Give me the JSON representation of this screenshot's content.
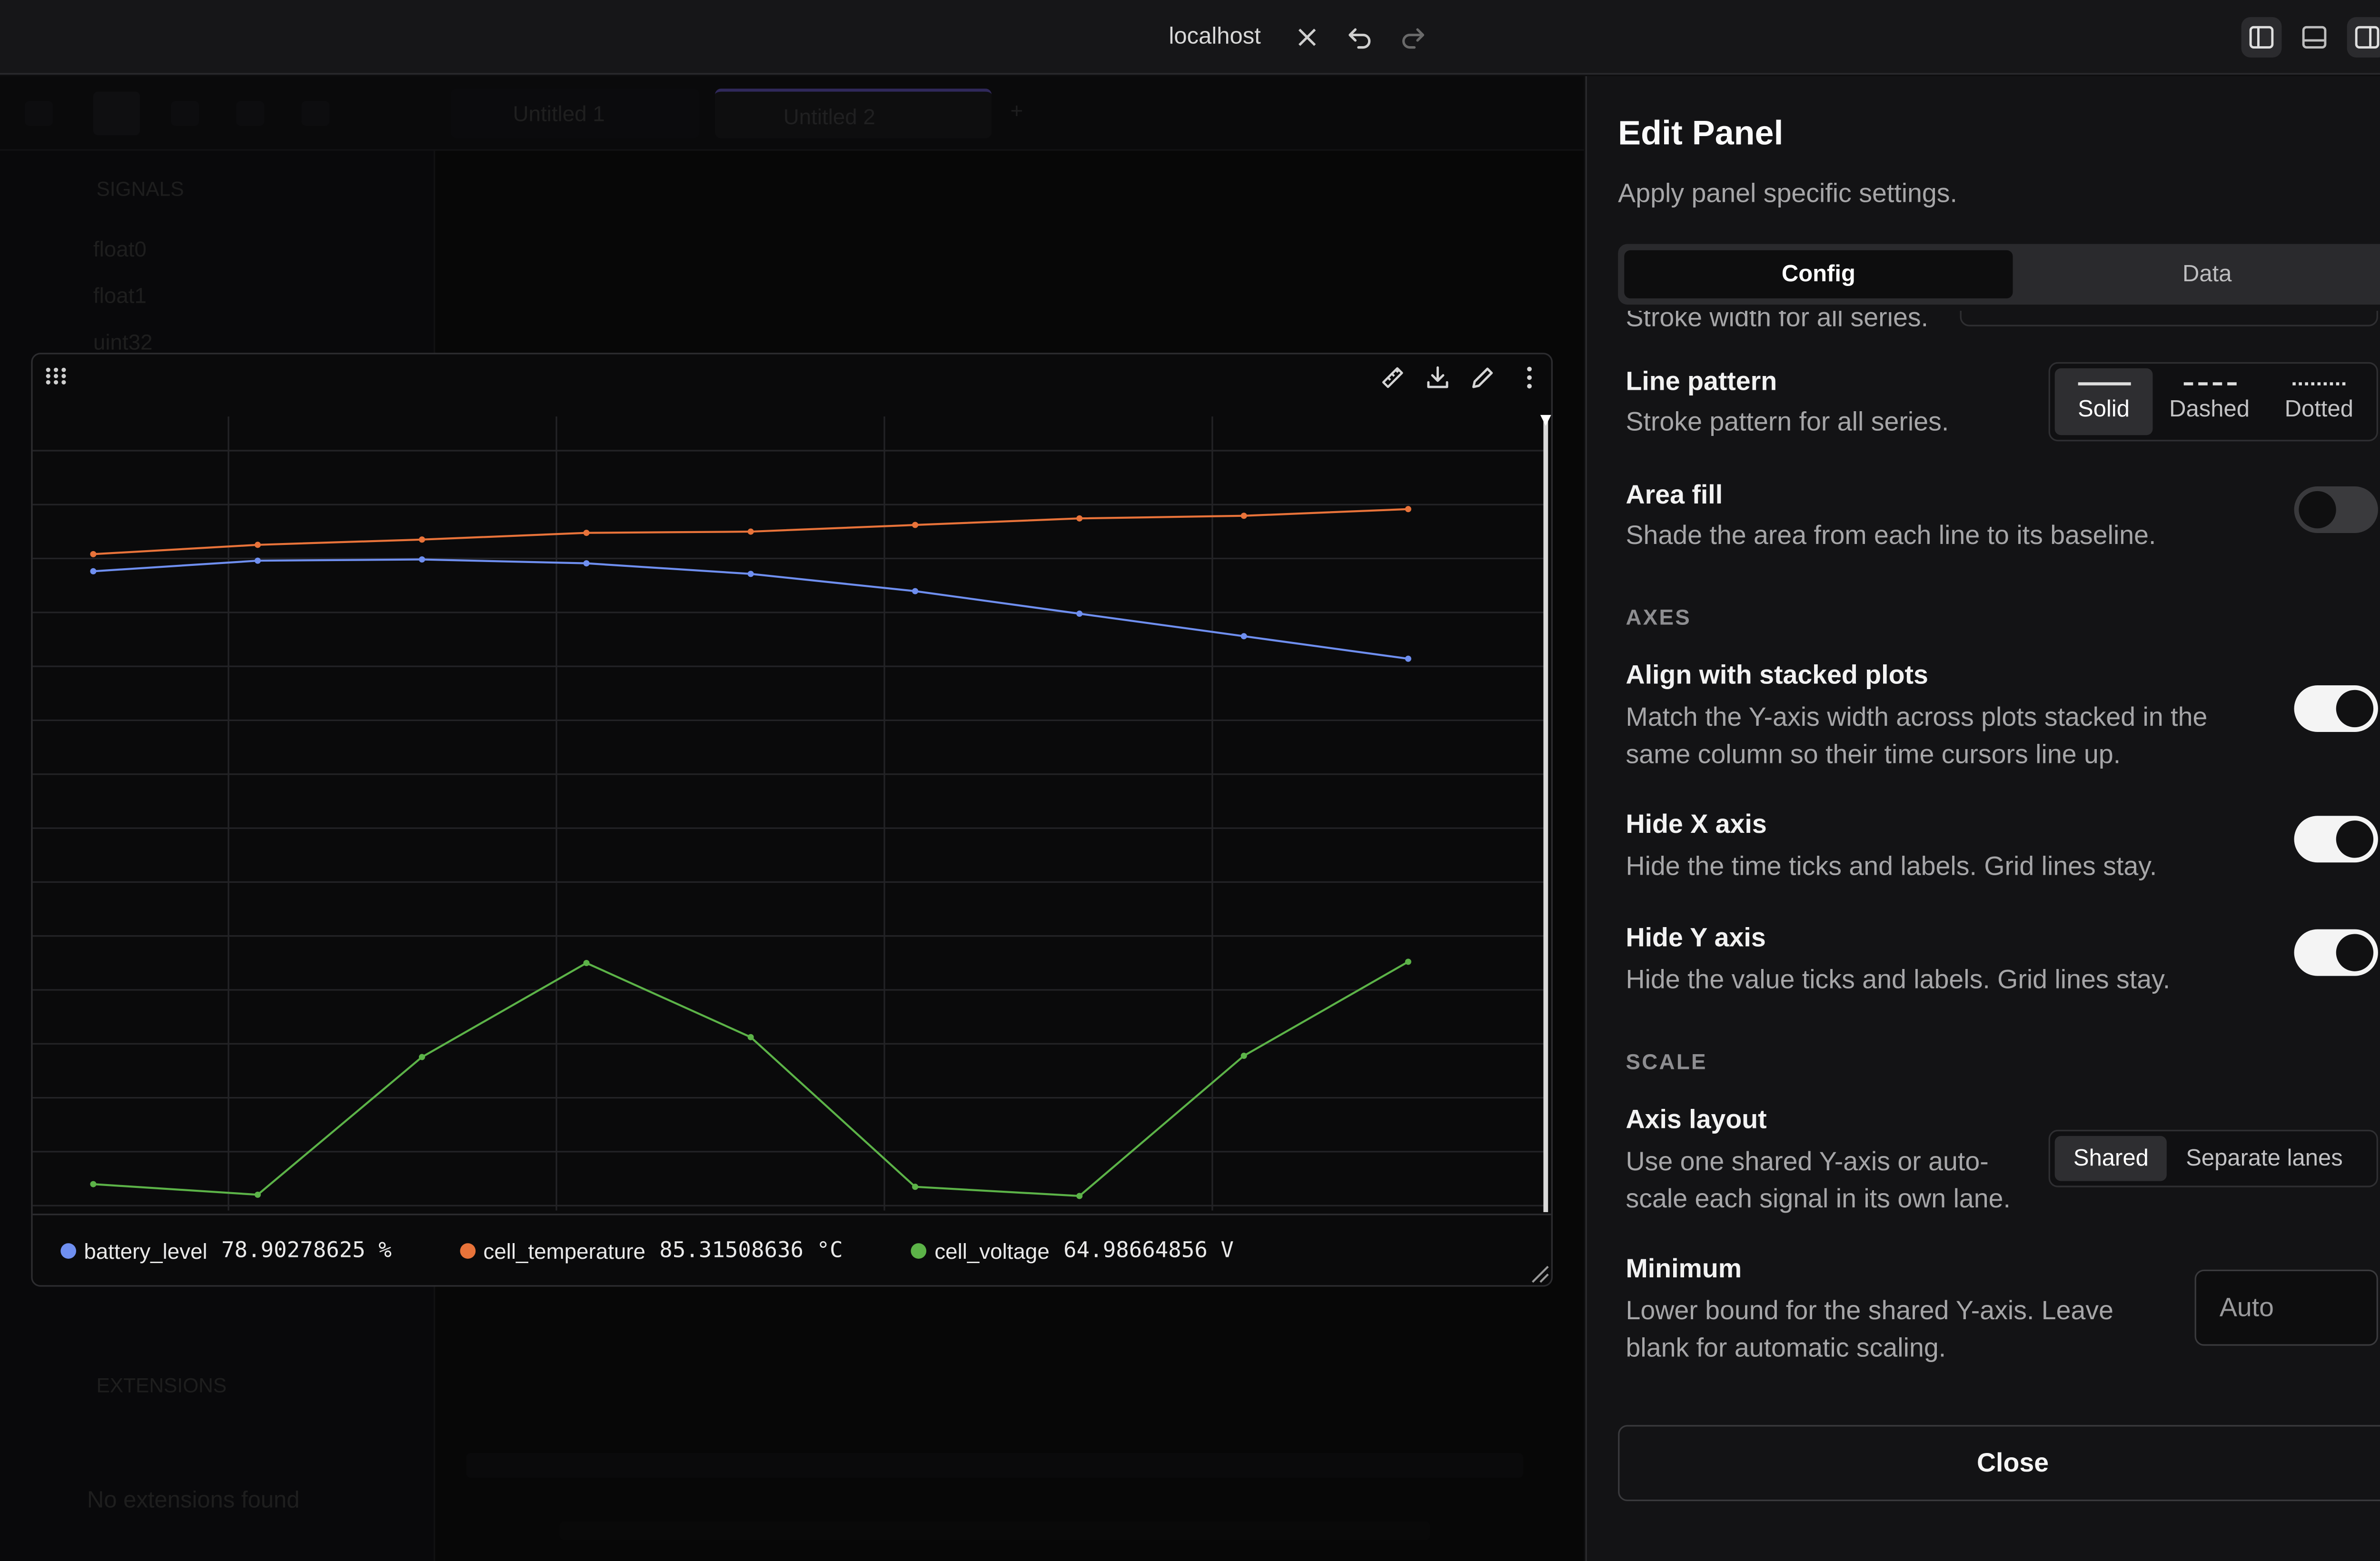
{
  "window": {
    "title": "localhost"
  },
  "background_app": {
    "tabs": [
      "Untitled 1",
      "Untitled 2"
    ],
    "sidebar": {
      "section_title": "SIGNALS",
      "items": [
        "float0",
        "float1",
        "uint32"
      ],
      "extensions_title": "EXTENSIONS",
      "extensions_empty": "No extensions found"
    }
  },
  "chart_panel": {
    "legend": [
      {
        "name": "battery_level",
        "value": "78.90278625 %",
        "color": "#6f8ff0"
      },
      {
        "name": "cell_temperature",
        "value": "85.31508636 °C",
        "color": "#e8733a"
      },
      {
        "name": "cell_voltage",
        "value": "64.98664856 V",
        "color": "#5cb348"
      }
    ]
  },
  "chart_data": {
    "type": "line",
    "x": [
      1,
      2,
      3,
      4,
      5,
      6,
      7,
      8,
      9
    ],
    "series": [
      {
        "name": "battery_level",
        "color": "#6f8ff0",
        "values": [
          80.3,
          81.1,
          81.2,
          80.9,
          80.1,
          78.8,
          77.1,
          75.4,
          73.7
        ]
      },
      {
        "name": "cell_temperature",
        "color": "#e8733a",
        "values": [
          81.6,
          82.3,
          82.7,
          83.2,
          83.3,
          83.8,
          84.3,
          84.5,
          85.0
        ]
      },
      {
        "name": "cell_voltage",
        "color": "#5cb348",
        "values": [
          34.0,
          33.2,
          43.6,
          50.7,
          45.1,
          33.8,
          33.1,
          43.7,
          50.8
        ]
      }
    ],
    "ylim": [
      32,
      92
    ],
    "grid": true,
    "x_axis_hidden": true,
    "y_axis_hidden": true
  },
  "edit_panel": {
    "title": "Edit Panel",
    "subtitle": "Apply panel specific settings.",
    "tabs": {
      "config": "Config",
      "data": "Data"
    },
    "stroke_width_desc": "Stroke width for all series.",
    "line_pattern": {
      "title": "Line pattern",
      "desc": "Stroke pattern for all series.",
      "options": [
        "Solid",
        "Dashed",
        "Dotted"
      ],
      "selected": "Solid"
    },
    "area_fill": {
      "title": "Area fill",
      "desc": "Shade the area from each line to its baseline.",
      "enabled": false
    },
    "axes_section": "AXES",
    "align_stacked": {
      "title": "Align with stacked plots",
      "desc1": "Match the Y-axis width across plots stacked in the",
      "desc2": "same column so their time cursors line up.",
      "enabled": true
    },
    "hide_x": {
      "title": "Hide X axis",
      "desc": "Hide the time ticks and labels. Grid lines stay.",
      "enabled": true
    },
    "hide_y": {
      "title": "Hide Y axis",
      "desc": "Hide the value ticks and labels. Grid lines stay.",
      "enabled": true
    },
    "scale_section": "SCALE",
    "axis_layout": {
      "title": "Axis layout",
      "desc1": "Use one shared Y-axis or auto-",
      "desc2": "scale each signal in its own lane.",
      "options": [
        "Shared",
        "Separate lanes"
      ],
      "selected": "Shared"
    },
    "minimum": {
      "title": "Minimum",
      "desc1": "Lower bound for the shared Y-axis. Leave",
      "desc2": "blank for automatic scaling.",
      "placeholder": "Auto"
    },
    "close_button": "Close"
  }
}
